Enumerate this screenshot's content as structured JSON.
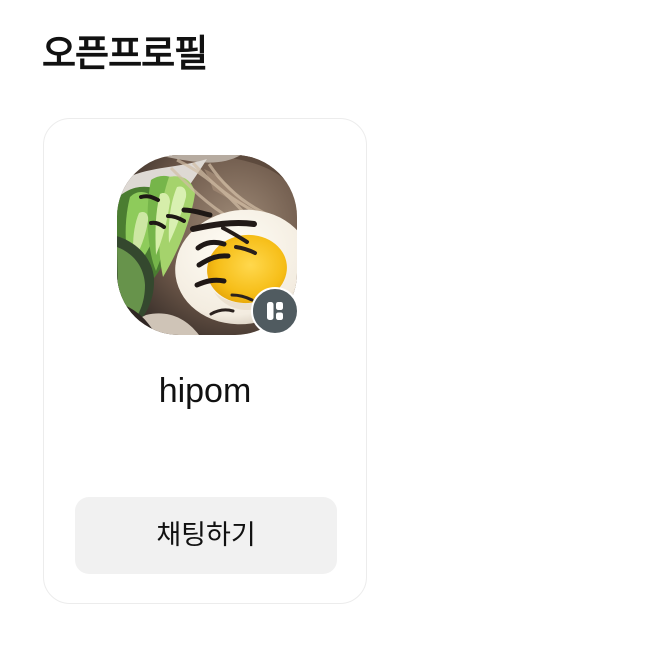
{
  "page": {
    "title": "오픈프로필"
  },
  "profile_card": {
    "avatar_icon": "food-profile-photo",
    "badge_icon": "open-profile-badge-icon",
    "name": "hipom",
    "chat_button_label": "채팅하기"
  },
  "colors": {
    "background": "#ffffff",
    "text": "#111111",
    "card_border": "#ececec",
    "button_background": "#f1f1f1",
    "badge_background": "#505b60"
  }
}
